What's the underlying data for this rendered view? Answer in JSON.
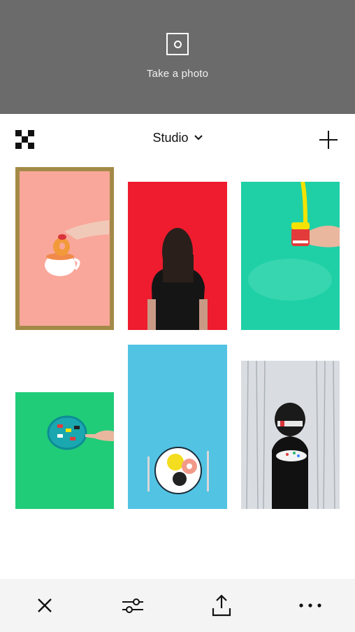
{
  "camera": {
    "label": "Take a photo",
    "background": "#6b6b6b"
  },
  "toolbar": {
    "title": "Studio",
    "title_icon": "chevron-down-icon",
    "left_icon": "studio-checker-icon",
    "right_icon": "plus-icon"
  },
  "photos": [
    {
      "id": "donut-tea",
      "background": "#f9a79a",
      "selected": true
    },
    {
      "id": "red-back-girl",
      "background": "#ee1c2e",
      "selected": false
    },
    {
      "id": "teal-chatter-teeth",
      "background": "#1fd0a6",
      "selected": false
    },
    {
      "id": "green-toy-cars",
      "background": "#20cc78",
      "selected": false
    },
    {
      "id": "blue-donut-plate",
      "background": "#52c3e3",
      "selected": false
    },
    {
      "id": "silver-astronaut",
      "background": "#d9dde1",
      "selected": false
    }
  ],
  "colors": {
    "selection_border": "#a38a47",
    "bottom_bar": "#f4f4f4"
  },
  "bottom_bar": {
    "items": [
      "close-icon",
      "adjust-sliders-icon",
      "share-icon",
      "more-icon"
    ]
  }
}
